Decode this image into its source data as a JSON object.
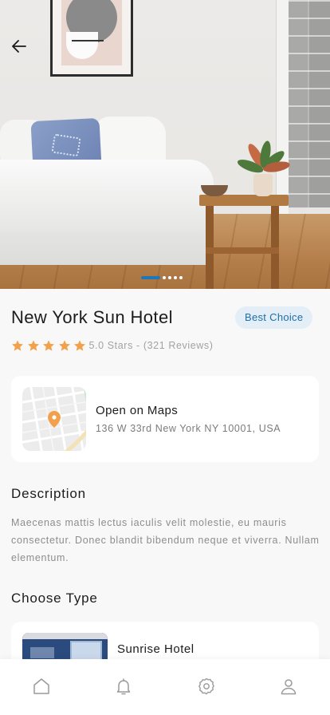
{
  "hero": {
    "image_description_icon": "photo-bedroom",
    "back_icon": "arrow-left-icon",
    "carousel": {
      "total": 5,
      "active_index": 0
    }
  },
  "hotel": {
    "name": "New York Sun Hotel",
    "badge": "Best Choice",
    "rating": {
      "stars": 5,
      "text": "5.0 Stars - (321 Reviews)"
    }
  },
  "location": {
    "title": "Open on Maps",
    "address": "136 W 33rd New York NY 10001, USA"
  },
  "description": {
    "heading": "Description",
    "text": "Maecenas mattis lectus iaculis velit molestie, eu  mauris consectetur. Donec blandit bibendum neque et viverra. Nullam elementum."
  },
  "choose_type": {
    "heading": "Choose Type",
    "items": [
      {
        "name": "Sunrise Hotel"
      }
    ]
  },
  "bottom_nav": {
    "items": [
      {
        "icon": "home-icon"
      },
      {
        "icon": "bell-icon"
      },
      {
        "icon": "gear-icon"
      },
      {
        "icon": "user-icon"
      }
    ]
  },
  "colors": {
    "accent": "#1d78b8",
    "star": "#f2a049",
    "badge_bg": "#e3eef6",
    "badge_text": "#1e6fa8",
    "map_pin": "#f2a049"
  }
}
